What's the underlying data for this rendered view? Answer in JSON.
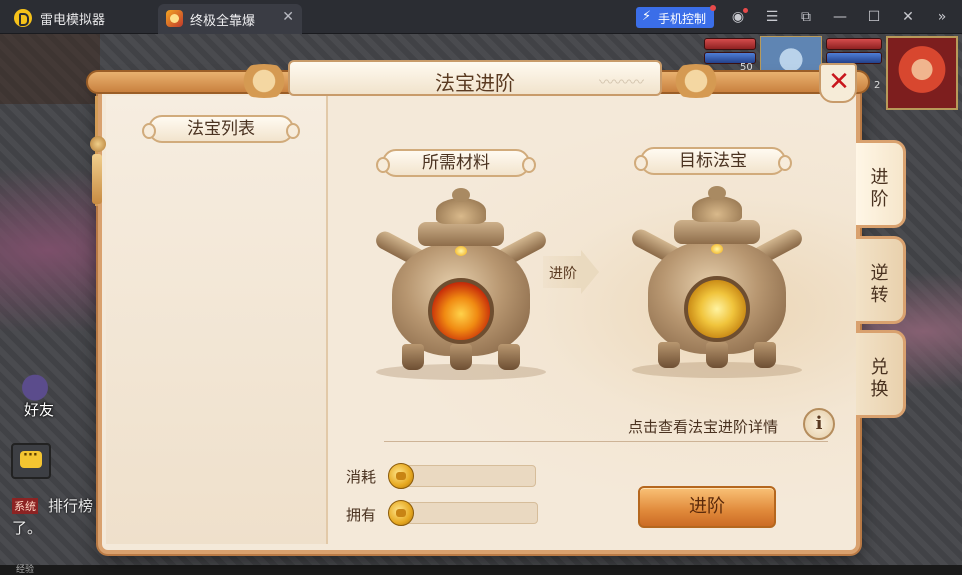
{
  "titlebar": {
    "app_name": "雷电模拟器",
    "tab_label": "终极全靠爆",
    "tab_close": "✕",
    "phone_control": "手机控制",
    "icons": [
      "lightning-icon",
      "user-icon",
      "menu-icon",
      "external-icon",
      "minimize-icon",
      "maximize-icon",
      "close-icon",
      "expand-icon"
    ]
  },
  "game": {
    "friend_label": "好友",
    "chat_tag": "系统",
    "chat_line1": "排行榜",
    "chat_line2": "了。",
    "stat_num_1": "50",
    "stat_num_2": "2",
    "bottom_text": "经验"
  },
  "dialog": {
    "title": "法宝进阶",
    "list_label": "法宝列表",
    "materials_label": "所需材料",
    "target_label": "目标法宝",
    "arrow_label": "进阶",
    "detail_link": "点击查看法宝进阶详情",
    "info_icon": "i",
    "cost_label": "消耗",
    "own_label": "拥有",
    "cost_value": "",
    "own_value": "",
    "advance_button": "进阶",
    "tabs": [
      {
        "line1": "进",
        "line2": "阶",
        "active": true
      },
      {
        "line1": "逆",
        "line2": "转",
        "active": false
      },
      {
        "line1": "兑",
        "line2": "换",
        "active": false
      }
    ]
  },
  "colors": {
    "accent_phone": "#3b6ee8",
    "dialog_border": "#d9a16e",
    "close_red": "#c8161c",
    "advance_btn": "#e0893a"
  }
}
